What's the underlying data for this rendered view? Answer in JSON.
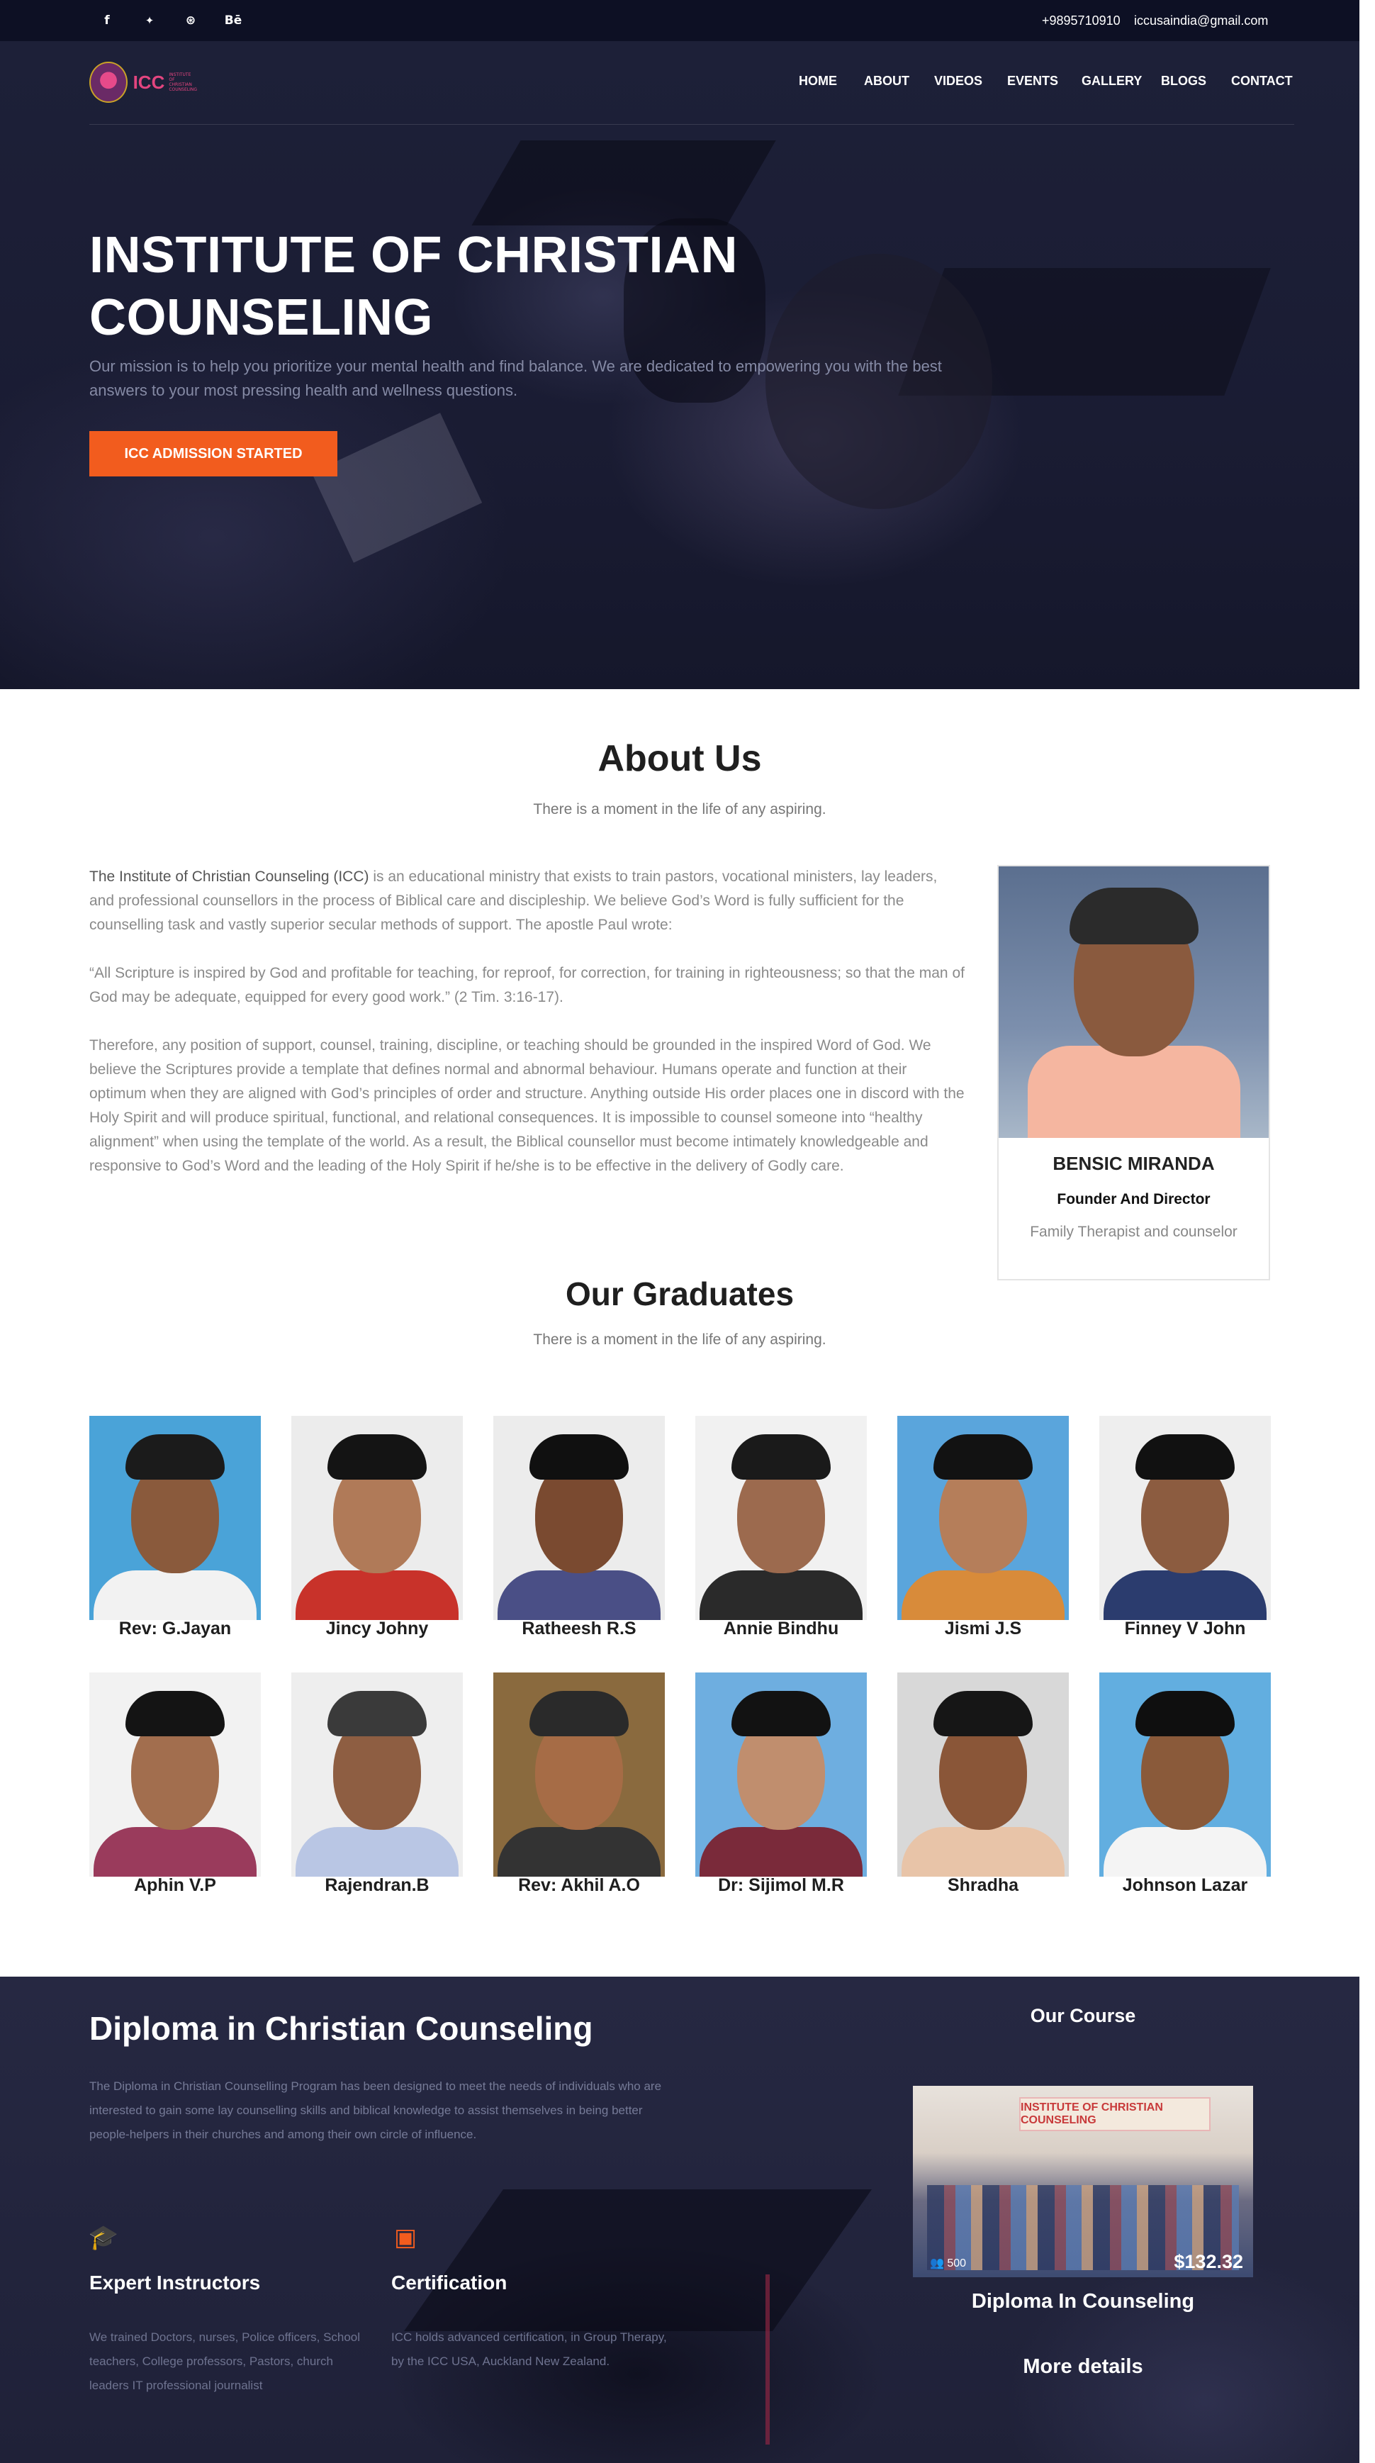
{
  "topbar": {
    "social": [
      {
        "icon": "facebook-icon",
        "glyph": "f"
      },
      {
        "icon": "twitter-icon",
        "glyph": "🐦"
      },
      {
        "icon": "dribbble-icon",
        "glyph": "⊛"
      },
      {
        "icon": "behance-icon",
        "glyph": "Bē"
      }
    ],
    "phone": "+9895710910",
    "email": "iccusaindia@gmail.com"
  },
  "header": {
    "logo_text": "ICC",
    "logo_sub": "INSTITUTE OF CHRISTIAN COUNSELING",
    "nav": [
      "HOME",
      "ABOUT",
      "VIDEOS",
      "EVENTS",
      "GALLERY",
      "BLOGS",
      "CONTACT"
    ]
  },
  "hero": {
    "title_line1": "INSTITUTE OF CHRISTIAN",
    "title_line2": "COUNSELING",
    "description": "Our mission is to help you prioritize your mental health and find balance. We are dedicated to empowering you with the best answers to your most pressing health and wellness questions.",
    "button": "ICC ADMISSION STARTED"
  },
  "about": {
    "title": "About Us",
    "subtitle": "There is a moment in the life of any aspiring.",
    "p1_lead": "The Institute of Christian Counseling (ICC)",
    "p1_rest": " is an educational ministry that exists to train pastors, vocational ministers, lay leaders, and professional counsellors in the process of Biblical care and discipleship. We believe God’s Word is fully sufficient for the counselling task and vastly superior secular methods of support. The apostle Paul wrote:",
    "p2": "“All Scripture is inspired by God and profitable for teaching, for reproof, for correction, for training in righteousness; so that the man of God may be adequate, equipped for every good work.” (2 Tim. 3:16-17).",
    "p3": "Therefore, any position of support, counsel, training, discipline, or teaching should be grounded in the inspired Word of God. We believe the Scriptures provide a template that defines normal and abnormal behaviour. Humans operate and function at their optimum when they are aligned with God’s principles of order and structure. Anything outside His order places one in discord with the Holy Spirit and will produce spiritual, functional, and relational consequences. It is impossible to counsel someone into “healthy alignment” when using the template of the world. As a result, the Biblical counsellor must become intimately knowledgeable and responsive to God’s Word and the leading of the Holy Spirit if he/she is to be effective in the delivery of Godly care.",
    "card": {
      "name": "BENSIC MIRANDA",
      "role": "Founder And Director",
      "description": "Family Therapist and counselor"
    }
  },
  "graduates": {
    "title": "Our Graduates",
    "subtitle": "There is a moment in the life of any aspiring.",
    "people": [
      {
        "name": "Rev: G.Jayan",
        "bg": "#4aa3d8",
        "hair": "#1b1b1b",
        "skin": "#8a5a3c",
        "shirt": "#f2f2f2"
      },
      {
        "name": "Jincy Johny",
        "bg": "#ececec",
        "hair": "#141414",
        "skin": "#b07a58",
        "shirt": "#c8322a"
      },
      {
        "name": "Ratheesh R.S",
        "bg": "#ececec",
        "hair": "#101010",
        "skin": "#7a4a30",
        "shirt": "#4a4f86"
      },
      {
        "name": "Annie Bindhu",
        "bg": "#f1f1f1",
        "hair": "#1a1a1a",
        "skin": "#9c6a4e",
        "shirt": "#2a2a2a"
      },
      {
        "name": "Jismi J.S",
        "bg": "#5aa5dc",
        "hair": "#121212",
        "skin": "#b57e5a",
        "shirt": "#d88b3a"
      },
      {
        "name": "Finney V John",
        "bg": "#eeeeee",
        "hair": "#111111",
        "skin": "#8c5c40",
        "shirt": "#2b3c6e"
      },
      {
        "name": "Aphin V.P",
        "bg": "#f2f2f2",
        "hair": "#141414",
        "skin": "#a26e4e",
        "shirt": "#9a3b5c"
      },
      {
        "name": "Rajendran.B",
        "bg": "#eeeeee",
        "hair": "#3a3a3a",
        "skin": "#8e5e42",
        "shirt": "#b9c6e4"
      },
      {
        "name": "Rev: Akhil A.O",
        "bg": "#8a6a3e",
        "hair": "#2a2a2a",
        "skin": "#a66c46",
        "shirt": "#333333"
      },
      {
        "name": "Dr: Sijimol M.R",
        "bg": "#6eaee0",
        "hair": "#121212",
        "skin": "#c08e6e",
        "shirt": "#7a2a3a"
      },
      {
        "name": "Shradha",
        "bg": "#d8d8d8",
        "hair": "#161616",
        "skin": "#8a5638",
        "shirt": "#e8c4a8"
      },
      {
        "name": "Johnson Lazar",
        "bg": "#62aee0",
        "hair": "#0f0f0f",
        "skin": "#8a5a3a",
        "shirt": "#f4f4f4"
      }
    ]
  },
  "diploma": {
    "title": "Diploma in Christian Counseling",
    "description": "The Diploma in Christian Counselling Program has been designed to meet the needs of individuals who are interested to gain some lay counselling skills and biblical knowledge to assist themselves in being better people-helpers in their churches and among their own circle of influence.",
    "features": [
      {
        "icon": "graduation-cap-icon",
        "glyph": "🎓",
        "title": "Expert Instructors",
        "text": "We trained Doctors, nurses, Police officers, School teachers, College professors, Pastors, church leaders IT professional journalist"
      },
      {
        "icon": "certificate-icon",
        "glyph": "🏅",
        "title": "Certification",
        "text": "ICC holds advanced certification, in Group Therapy, by the ICC USA, Auckland New Zealand."
      }
    ],
    "course": {
      "heading": "Our Course",
      "banner": "INSTITUTE OF CHRISTIAN COUNSELING",
      "count": "500",
      "price": "$132.32",
      "name": "Diploma In Counseling",
      "more": "More details"
    }
  },
  "colors": {
    "accent": "#f25c1e",
    "topbar": "#0d1024",
    "hero_bg": "#1d2038",
    "footer_bg": "#262842"
  }
}
